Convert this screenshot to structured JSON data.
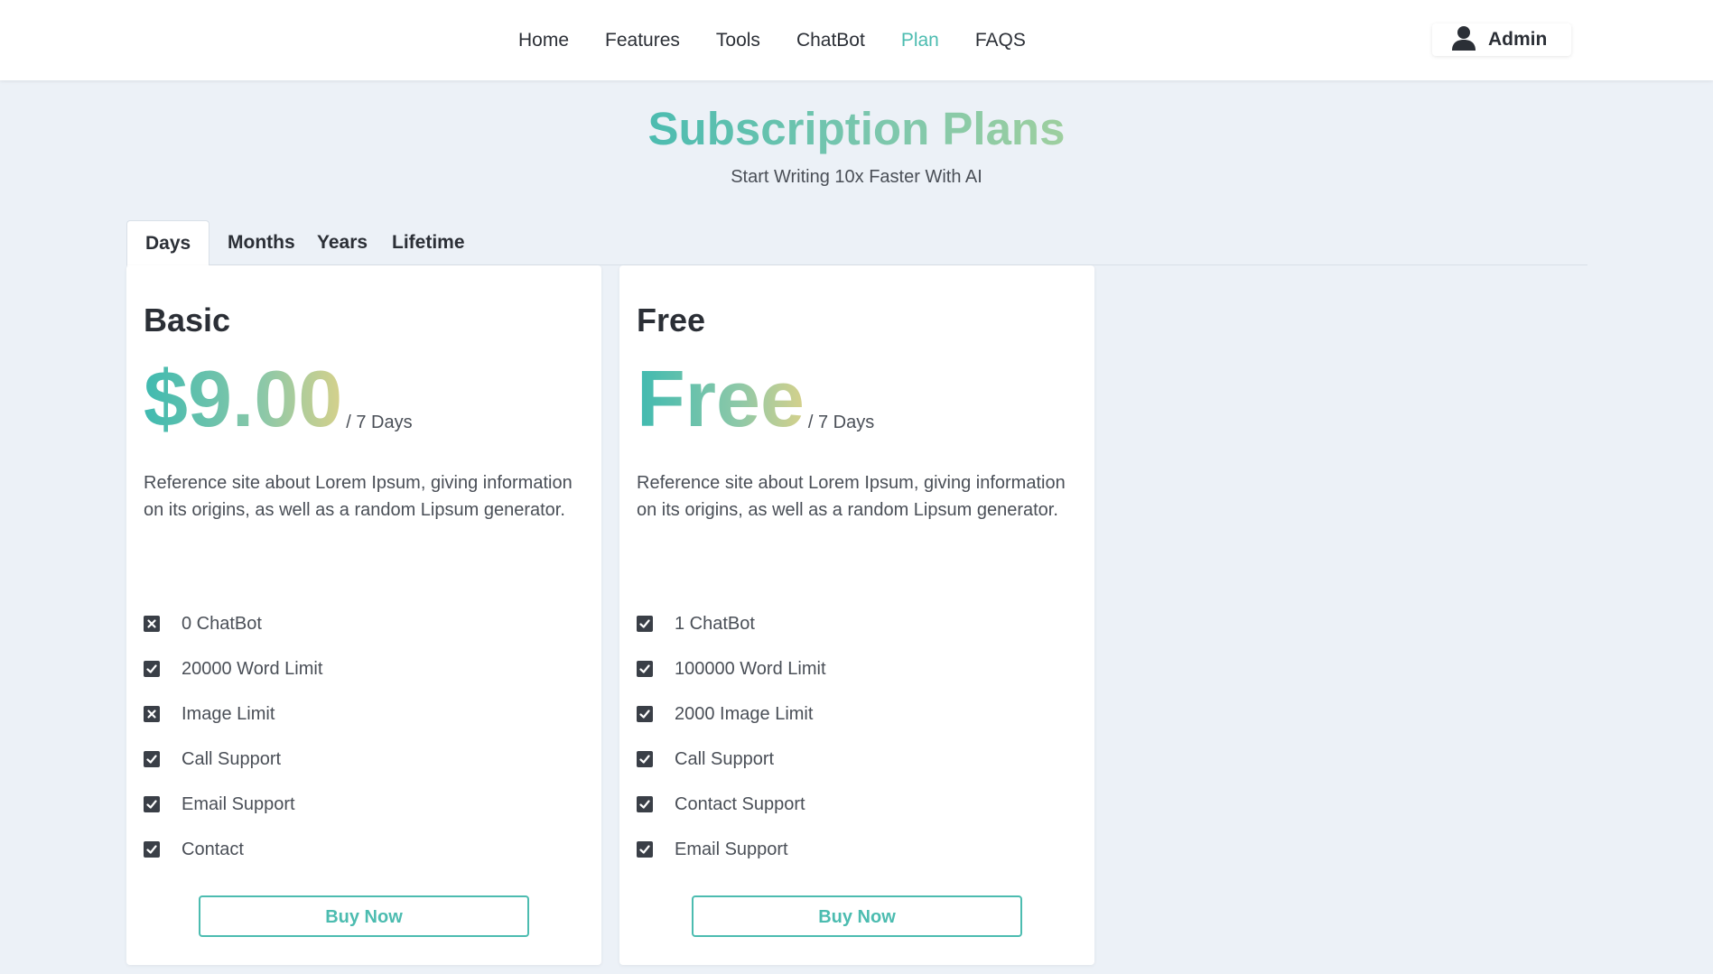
{
  "nav": {
    "items": [
      {
        "label": "Home",
        "active": false
      },
      {
        "label": "Features",
        "active": false
      },
      {
        "label": "Tools",
        "active": false
      },
      {
        "label": "ChatBot",
        "active": false
      },
      {
        "label": "Plan",
        "active": true
      },
      {
        "label": "FAQS",
        "active": false
      }
    ],
    "user_label": "Admin",
    "user_icon": "user-icon"
  },
  "hero": {
    "title": "Subscription Plans",
    "subtitle": "Start Writing 10x Faster With AI"
  },
  "tabs": [
    "Days",
    "Months",
    "Years",
    "Lifetime"
  ],
  "active_tab": "Days",
  "plans": [
    {
      "name": "Basic",
      "price": "$9.00",
      "period": "/ 7 Days",
      "description": "Reference site about Lorem Ipsum, giving information on its origins, as well as a random Lipsum generator.",
      "features": [
        {
          "label": "0 ChatBot",
          "included": false
        },
        {
          "label": "20000 Word Limit",
          "included": true
        },
        {
          "label": "Image Limit",
          "included": false
        },
        {
          "label": "Call Support",
          "included": true
        },
        {
          "label": "Email Support",
          "included": true
        },
        {
          "label": "Contact",
          "included": true
        }
      ],
      "button": "Buy Now"
    },
    {
      "name": "Free",
      "price": "Free",
      "period": "/ 7 Days",
      "description": "Reference site about Lorem Ipsum, giving information on its origins, as well as a random Lipsum generator.",
      "features": [
        {
          "label": "1 ChatBot",
          "included": true
        },
        {
          "label": "100000 Word Limit",
          "included": true
        },
        {
          "label": "2000 Image Limit",
          "included": true
        },
        {
          "label": "Call Support",
          "included": true
        },
        {
          "label": "Contact Support",
          "included": true
        },
        {
          "label": "Email Support",
          "included": true
        }
      ],
      "button": "Buy Now"
    }
  ],
  "colors": {
    "accent": "#4cbcb0",
    "background": "#ecf1f7",
    "text": "#2b2f36"
  }
}
